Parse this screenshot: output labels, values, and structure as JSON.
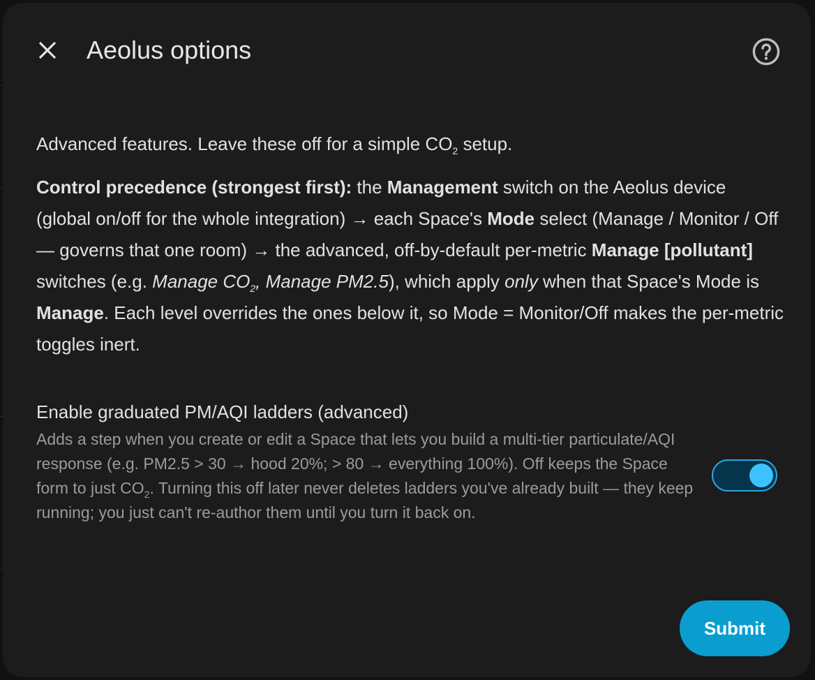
{
  "dialog": {
    "title": "Aeolus options",
    "close_icon": "close-icon",
    "help_icon": "help-circle-icon"
  },
  "intro": {
    "before": "Advanced features. Leave these off for a simple CO",
    "sub": "2",
    "after": " setup."
  },
  "precedence": {
    "heading": "Control precedence (strongest first):",
    "t1": " the ",
    "b1": "Management",
    "t2": " switch on the Aeolus device (global on/off for the whole integration) → each Space's ",
    "b2": "Mode",
    "t3": " select (Manage / Monitor / Off — governs that one room) → the advanced, off-by-default per-metric ",
    "b3": "Manage [pollutant]",
    "t4": " switches (e.g. ",
    "i1": "Manage CO",
    "i1_sub": "2",
    "i2": ", Manage PM2.5",
    "t5": "), which apply ",
    "i3": "only",
    "t6": " when that Space's Mode is ",
    "b4": "Manage",
    "t7": ". Each level overrides the ones below it, so Mode = Monitor/Off makes the per-metric toggles inert."
  },
  "ladders_setting": {
    "label": "Enable graduated PM/AQI ladders (advanced)",
    "desc_part1": "Adds a step when you create or edit a Space that lets you build a multi-tier particulate/AQI response (e.g. PM2.5 > 30 → hood 20%; > 80 → everything 100%). Off keeps the Space form to just CO",
    "desc_sub": "2",
    "desc_part2": ". Turning this off later never deletes ladders you've already built — they keep running; you just can't re-author them until you turn it back on.",
    "enabled": true
  },
  "actions": {
    "submit_label": "Submit"
  },
  "colors": {
    "dialog_bg": "#1c1c1c",
    "accent": "#0a9ed0",
    "toggle_knob": "#3cc3ff",
    "secondary_text": "#9b9b9b"
  }
}
